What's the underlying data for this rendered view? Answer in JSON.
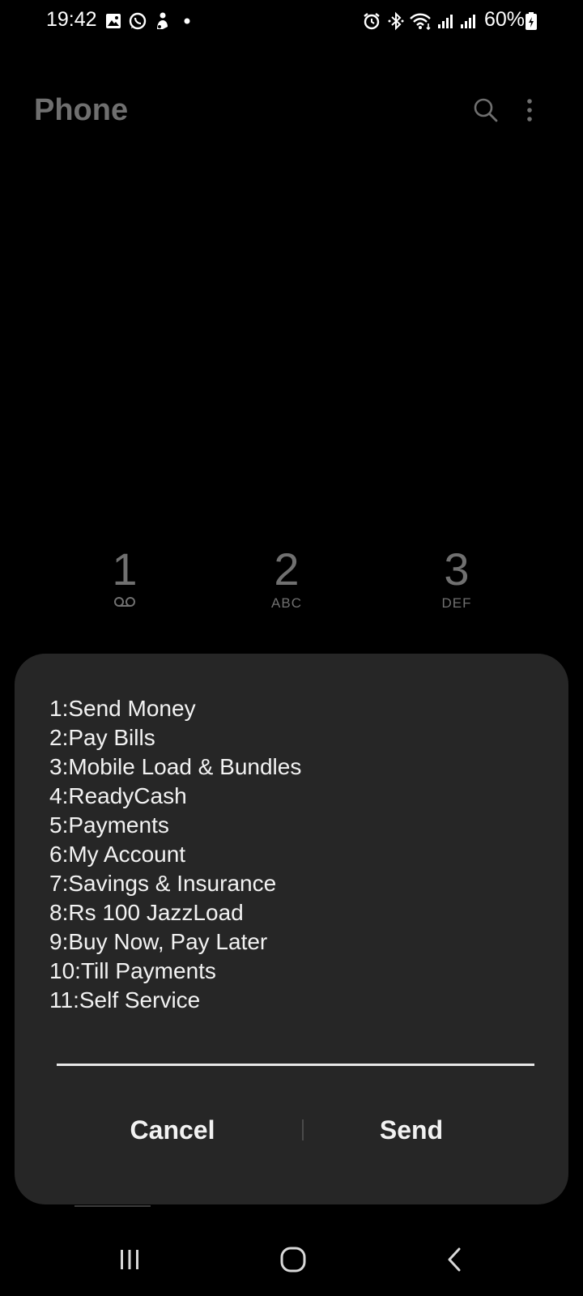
{
  "status_bar": {
    "time": "19:42",
    "battery": "60%",
    "left_icons": [
      "gallery-icon",
      "whatsapp-icon",
      "notification-icon",
      "dot-icon"
    ],
    "right_icons": [
      "alarm-icon",
      "bluetooth-icon",
      "wifi-icon",
      "signal-icon",
      "signal-icon",
      "battery-icon"
    ]
  },
  "app_bar": {
    "title": "Phone",
    "actions": [
      "search-icon",
      "more-options-icon"
    ]
  },
  "dialpad": {
    "keys": [
      {
        "digit": "1",
        "letters": "",
        "icon": "voicemail-icon"
      },
      {
        "digit": "2",
        "letters": "ABC"
      },
      {
        "digit": "3",
        "letters": "DEF"
      }
    ]
  },
  "dialog": {
    "lines": [
      "1:Send Money",
      "2:Pay Bills",
      "3:Mobile Load & Bundles",
      "4:ReadyCash",
      "5:Payments",
      "6:My Account",
      "7:Savings & Insurance",
      "8:Rs 100 JazzLoad",
      "9:Buy Now, Pay Later",
      "10:Till Payments",
      "11:Self Service"
    ],
    "input_value": "",
    "cancel_label": "Cancel",
    "send_label": "Send"
  },
  "colors": {
    "background": "#000000",
    "dialog_background": "#262626",
    "dimmed_text": "#6f6f6f",
    "text": "#f2f2f2"
  },
  "nav_bar": [
    "recents-icon",
    "home-icon",
    "back-icon"
  ]
}
